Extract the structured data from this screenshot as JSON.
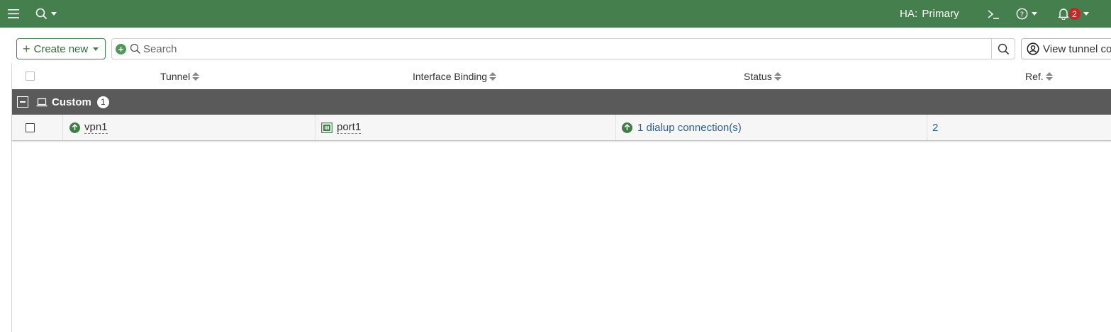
{
  "topbar": {
    "ha_key": "HA:",
    "ha_value": "Primary",
    "notification_count": "2",
    "icons": [
      "menu-icon",
      "search-icon",
      "cli-console-icon",
      "help-icon",
      "bell-icon"
    ]
  },
  "toolbar": {
    "create_label": "Create new",
    "search_placeholder": "Search",
    "view_label": "View tunnel co"
  },
  "table": {
    "columns": [
      "Tunnel",
      "Interface Binding",
      "Status",
      "Ref."
    ],
    "group": {
      "name": "Custom",
      "count": "1"
    },
    "rows": [
      {
        "tunnel": "vpn1",
        "interface": "port1",
        "status": "1 dialup connection(s)",
        "ref": "2"
      }
    ]
  },
  "colors": {
    "topbar_bg": "#457f4d",
    "group_bg": "#5a5a5a",
    "link": "#2b5f93",
    "badge": "#c62828",
    "status_up": "#3f7d47"
  }
}
